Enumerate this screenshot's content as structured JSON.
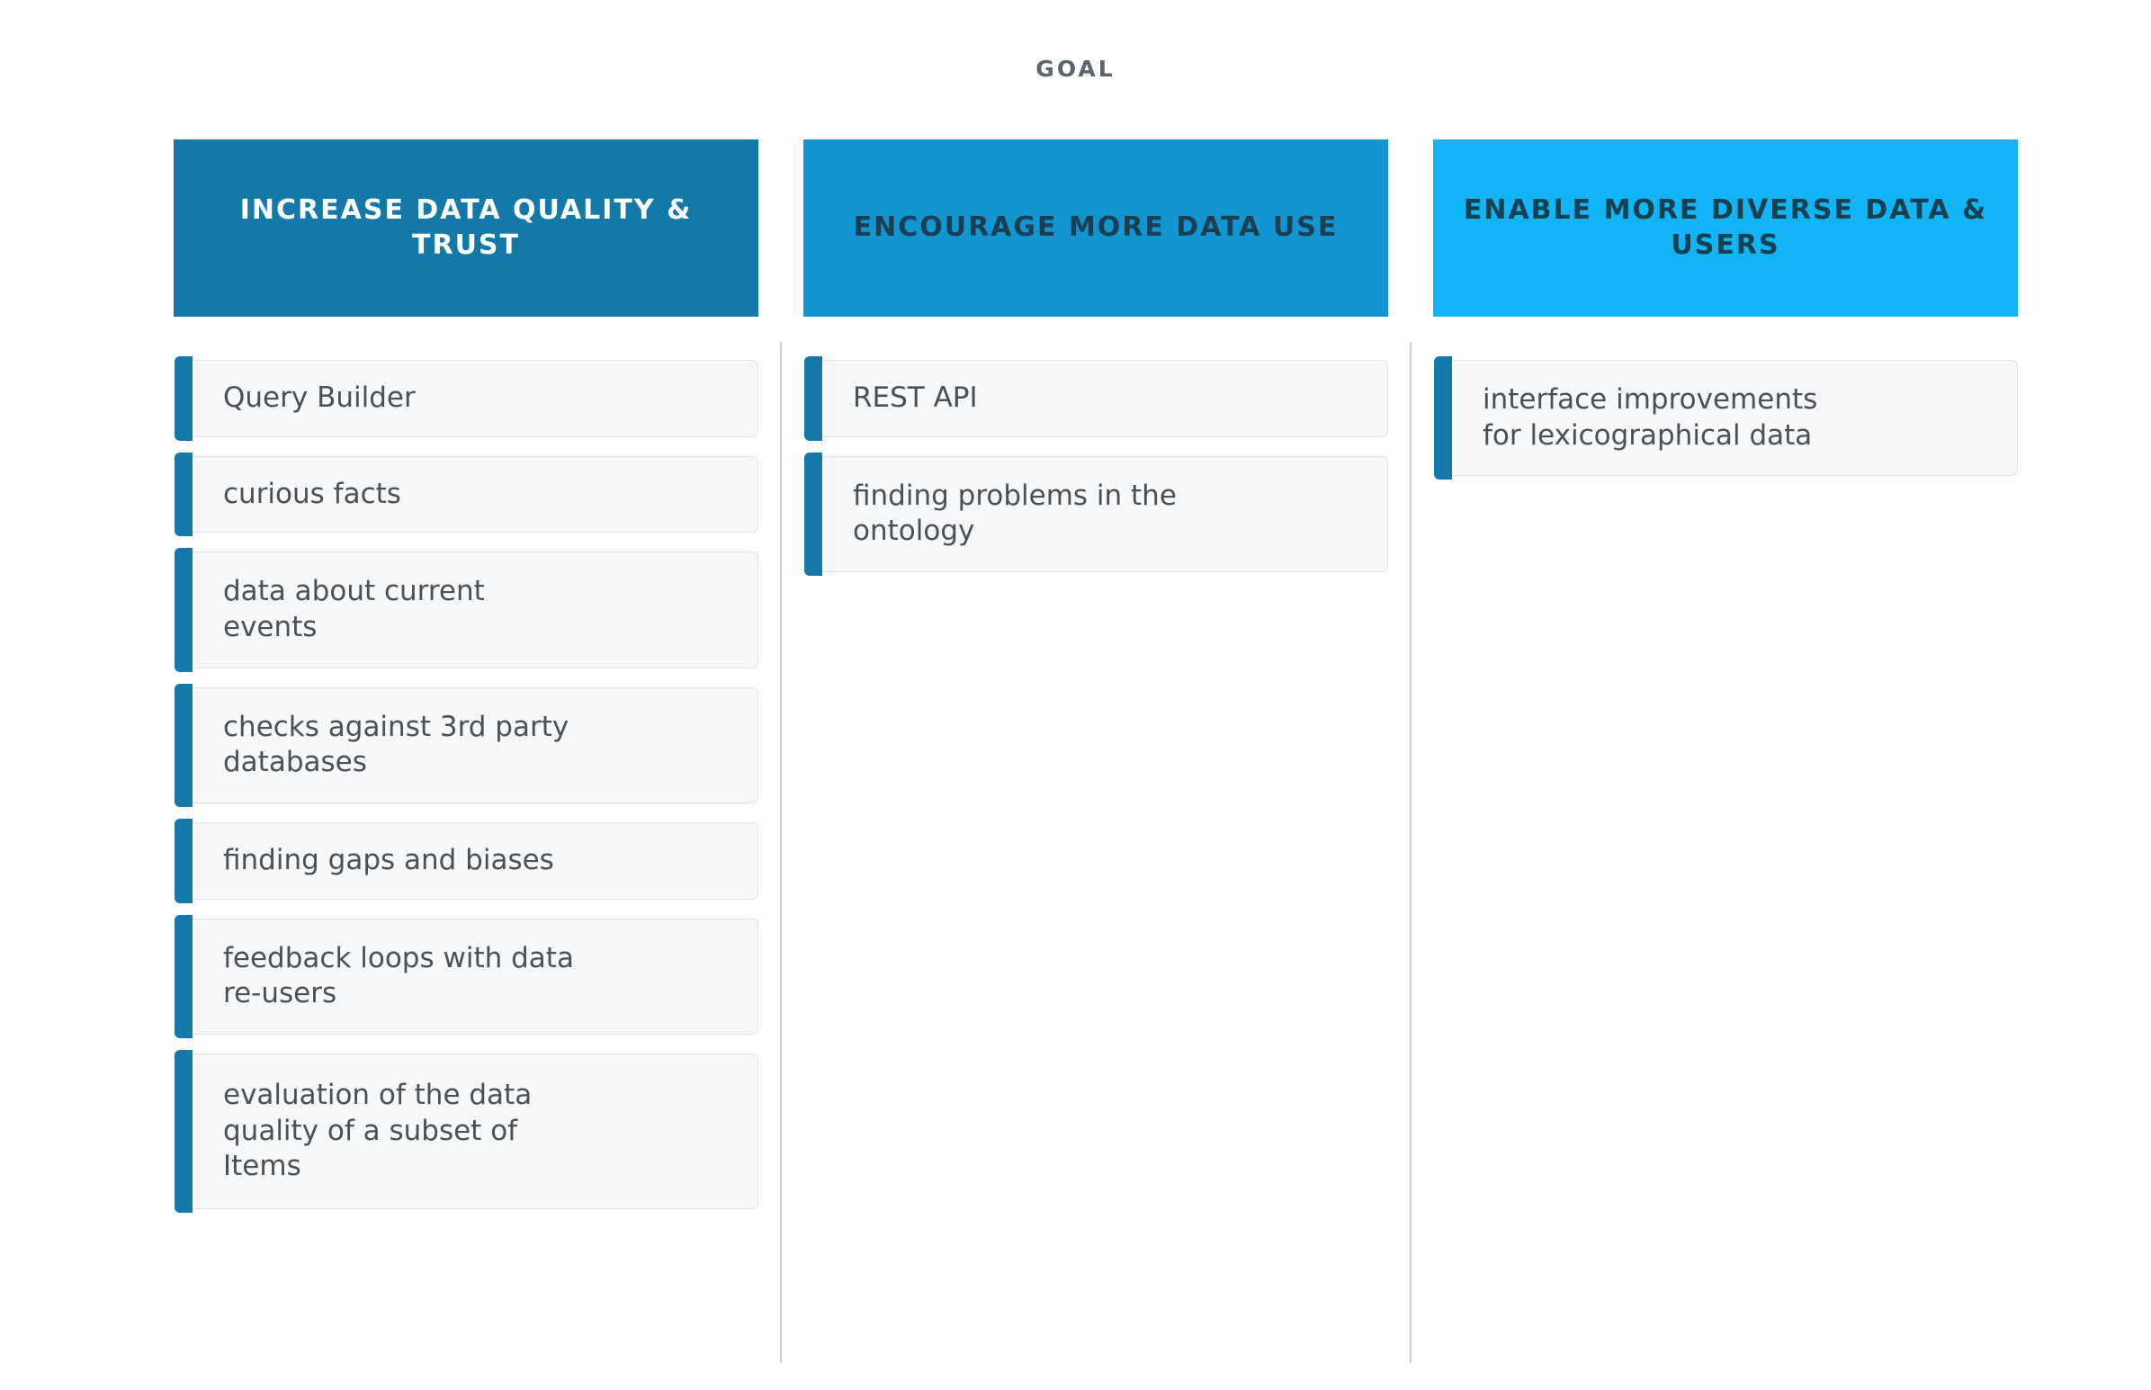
{
  "header": {
    "label": "GOAL"
  },
  "colors": {
    "column1_header_bg": "#1279a8",
    "column2_header_bg": "#1295d1",
    "column3_header_bg": "#12b4f5",
    "column1_header_text": "#ffffff",
    "column2_header_text": "#1b3f52",
    "column3_header_text": "#14404f",
    "card_bar": "#1279a8",
    "card_bg": "#f6f8f9",
    "card_border": "#dfe3e6",
    "card_text": "#4b5057",
    "divider": "#c9cfd4",
    "goal_label_text": "#5a6570",
    "page_bg": "#ffffff"
  },
  "columns": [
    {
      "title": "INCREASE DATA QUALITY & TRUST",
      "cards": [
        "Query Builder",
        "curious facts",
        "data about current\nevents",
        "checks against 3rd party\ndatabases",
        "finding gaps and biases",
        "feedback loops with data\nre-users",
        "evaluation of the data\nquality of a subset of\nItems"
      ]
    },
    {
      "title": "ENCOURAGE MORE DATA USE",
      "cards": [
        "REST API",
        "finding problems in the\nontology"
      ]
    },
    {
      "title": "ENABLE MORE DIVERSE DATA & USERS",
      "cards": [
        "interface improvements\nfor lexicographical data"
      ]
    }
  ]
}
